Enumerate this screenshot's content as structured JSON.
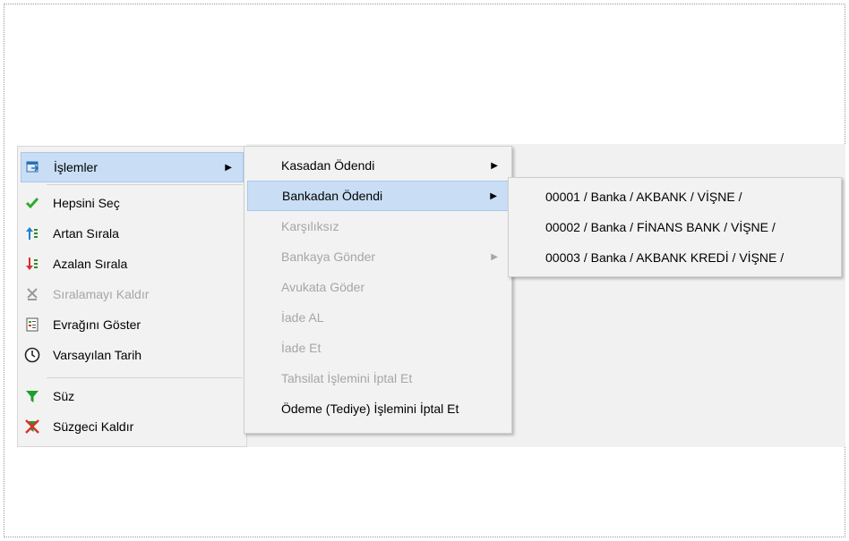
{
  "main_menu": {
    "items": [
      {
        "label": "İşlemler",
        "icon": "islemler-icon",
        "has_submenu": true,
        "highlighted": true
      },
      {
        "label": "Hepsini Seç",
        "icon": "checkmark-icon"
      },
      {
        "label": "Artan Sırala",
        "icon": "sort-ascending-icon"
      },
      {
        "label": "Azalan Sırala",
        "icon": "sort-descending-icon"
      },
      {
        "label": "Sıralamayı Kaldır",
        "icon": "remove-sort-icon",
        "disabled": true
      },
      {
        "label": "Evrağını Göster",
        "icon": "document-icon"
      },
      {
        "label": "Varsayılan Tarih",
        "icon": "clock-icon"
      },
      {
        "label": "Süz",
        "icon": "filter-icon"
      },
      {
        "label": "Süzgeci Kaldır",
        "icon": "remove-filter-icon"
      }
    ]
  },
  "submenu": {
    "items": [
      {
        "label": "Kasadan Ödendi",
        "has_submenu": true
      },
      {
        "label": "Bankadan  Ödendi",
        "has_submenu": true,
        "highlighted": true
      },
      {
        "label": "Karşılıksız",
        "disabled": true
      },
      {
        "label": "Bankaya Gönder",
        "disabled": true,
        "has_submenu": true
      },
      {
        "label": "Avukata Göder",
        "disabled": true
      },
      {
        "label": "İade AL",
        "disabled": true
      },
      {
        "label": "İade Et",
        "disabled": true
      },
      {
        "label": "Tahsilat İşlemini İptal Et",
        "disabled": true
      },
      {
        "label": "Ödeme (Tediye) İşlemini İptal Et"
      }
    ]
  },
  "bank_submenu": {
    "items": [
      {
        "label": "00001 / Banka / AKBANK / VİŞNE /"
      },
      {
        "label": "00002 / Banka / FİNANS BANK / VİŞNE /"
      },
      {
        "label": "00003 / Banka / AKBANK KREDİ / VİŞNE /"
      }
    ]
  },
  "colors": {
    "highlight": "#c9def5",
    "disabled_text": "#a6a6a6",
    "check_green": "#2eaa2e",
    "sort_red": "#d9302c",
    "sort_blue": "#1f7fd6",
    "filter_green": "#1f9e2a"
  }
}
